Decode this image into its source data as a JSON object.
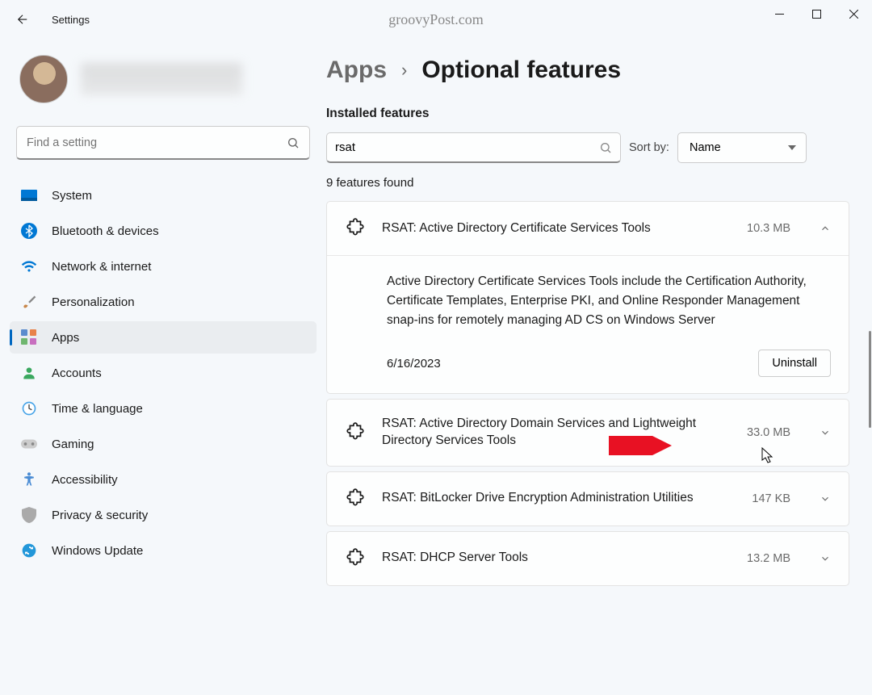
{
  "titlebar": {
    "title": "Settings",
    "watermark": "groovyPost.com"
  },
  "search": {
    "placeholder": "Find a setting"
  },
  "nav": {
    "items": [
      {
        "label": "System",
        "icon": "system"
      },
      {
        "label": "Bluetooth & devices",
        "icon": "bluetooth"
      },
      {
        "label": "Network & internet",
        "icon": "wifi"
      },
      {
        "label": "Personalization",
        "icon": "brush"
      },
      {
        "label": "Apps",
        "icon": "apps",
        "active": true
      },
      {
        "label": "Accounts",
        "icon": "person"
      },
      {
        "label": "Time & language",
        "icon": "clock"
      },
      {
        "label": "Gaming",
        "icon": "gamepad"
      },
      {
        "label": "Accessibility",
        "icon": "accessibility"
      },
      {
        "label": "Privacy & security",
        "icon": "shield"
      },
      {
        "label": "Windows Update",
        "icon": "update"
      }
    ]
  },
  "breadcrumb": {
    "parent": "Apps",
    "current": "Optional features"
  },
  "installed": {
    "section_title": "Installed features",
    "filter_value": "rsat",
    "sort_label": "Sort by:",
    "sort_value": "Name",
    "result_count": "9 features found"
  },
  "features": [
    {
      "name": "RSAT: Active Directory Certificate Services Tools",
      "size": "10.3 MB",
      "expanded": true,
      "description": "Active Directory Certificate Services Tools include the Certification Authority, Certificate Templates, Enterprise PKI, and Online Responder Management snap-ins for remotely managing AD CS on Windows Server",
      "date": "6/16/2023",
      "uninstall_label": "Uninstall"
    },
    {
      "name": "RSAT: Active Directory Domain Services and Lightweight Directory Services Tools",
      "size": "33.0 MB",
      "expanded": false
    },
    {
      "name": "RSAT: BitLocker Drive Encryption Administration Utilities",
      "size": "147 KB",
      "expanded": false
    },
    {
      "name": "RSAT: DHCP Server Tools",
      "size": "13.2 MB",
      "expanded": false
    }
  ]
}
